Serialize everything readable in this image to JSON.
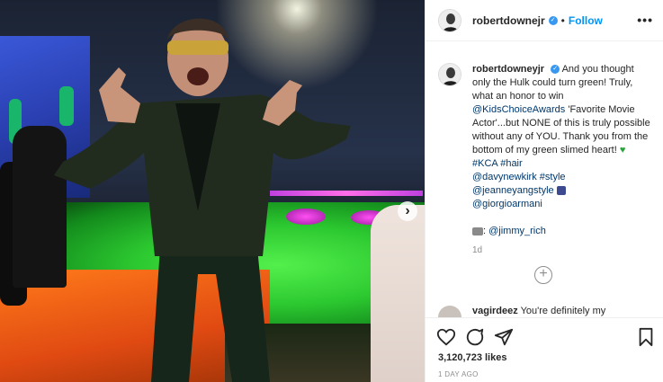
{
  "post": {
    "username": "robertdownejr",
    "separator": "•",
    "follow_label": "Follow",
    "more_label": "•••",
    "carousel_next": "›"
  },
  "caption": {
    "username": "robertdowneyjr",
    "line1": "And you thought only the Hulk could turn green! Truly, what an honor to win",
    "tag_kca_awards": "@KidsChoiceAwards",
    "line2": "'Favorite Movie Actor'...but NONE of this is truly possible without any of YOU. Thank you from the bottom of my green slimed heart!",
    "tag_kca": "#KCA",
    "tag_hair": "#hair",
    "mention_davy": "@davynewkirk",
    "tag_style": "#style",
    "mention_jeanne": "@jeanneyangstyle",
    "mention_giorgio": "@giorgioarmani",
    "photo_prefix": ":",
    "mention_jimmy": "@jimmy_rich",
    "time": "1d"
  },
  "comment": {
    "username": "vagirdeez",
    "text": "You're definitely my"
  },
  "footer": {
    "likes": "3,120,723 likes",
    "posted": "1 DAY AGO"
  },
  "colors": {
    "accent": "#0095f6",
    "link": "#00376b",
    "verified": "#3897f0"
  },
  "icons": [
    "heart-icon",
    "comment-icon",
    "share-icon",
    "bookmark-icon",
    "add-comment-icon",
    "verified-icon",
    "more-icon",
    "camera-icon"
  ]
}
